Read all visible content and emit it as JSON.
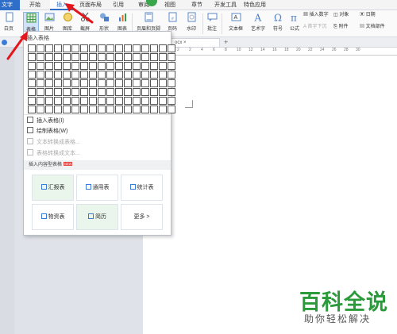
{
  "tabbar": {
    "app_menu": "文字",
    "tabs": [
      {
        "label": "开始"
      },
      {
        "label": "插入"
      },
      {
        "label": "页面布局"
      },
      {
        "label": "引用"
      },
      {
        "label": "审阅"
      },
      {
        "label": "视图"
      },
      {
        "label": "章节"
      },
      {
        "label": "开发工具"
      },
      {
        "label": "特色应用"
      }
    ]
  },
  "ribbon": {
    "first": "白页",
    "table": "表格",
    "picture": "图片",
    "gallery": "图库",
    "screenshot": "截屏",
    "shape": "形状",
    "chart": "图表",
    "header_footer": "页眉和页脚",
    "page_number": "页码",
    "watermark": "水印",
    "comment": "批注",
    "textbox": "文本框",
    "art_text": "艺术字",
    "symbol": "符号",
    "formula": "公式",
    "insert_number": "插入数字",
    "object": "对象",
    "date": "日期",
    "first_letter": "首字下沉",
    "attachment": "附件",
    "doc_parts": "文档部件"
  },
  "dropdown": {
    "header": "插入表格",
    "grid_columns": 17,
    "grid_rows": 8,
    "items": [
      {
        "label": "插入表格(I)"
      },
      {
        "label": "绘制表格(W)"
      },
      {
        "label": "文本转换成表格..."
      },
      {
        "label": "表格转换成文本..."
      }
    ],
    "section_title": "插入内容型表格",
    "section_badge": "NEW",
    "cards": [
      {
        "label": "汇报表"
      },
      {
        "label": "通用表"
      },
      {
        "label": "统计表"
      },
      {
        "label": "物资表"
      },
      {
        "label": "简历"
      },
      {
        "label": "更多 >"
      }
    ]
  },
  "ruler": {
    "labels": [
      "4",
      "2",
      "2",
      "4",
      "6",
      "8",
      "10",
      "12",
      "14",
      "16",
      "18",
      "20",
      "22",
      "24",
      "26",
      "28",
      "30"
    ]
  },
  "watermark": {
    "title": "百科全说",
    "subtitle": "助你轻松解决"
  },
  "colors": {
    "accent": "#2f6fc9",
    "arrow": "#e3161c",
    "brand_green": "#2a9a3a"
  }
}
